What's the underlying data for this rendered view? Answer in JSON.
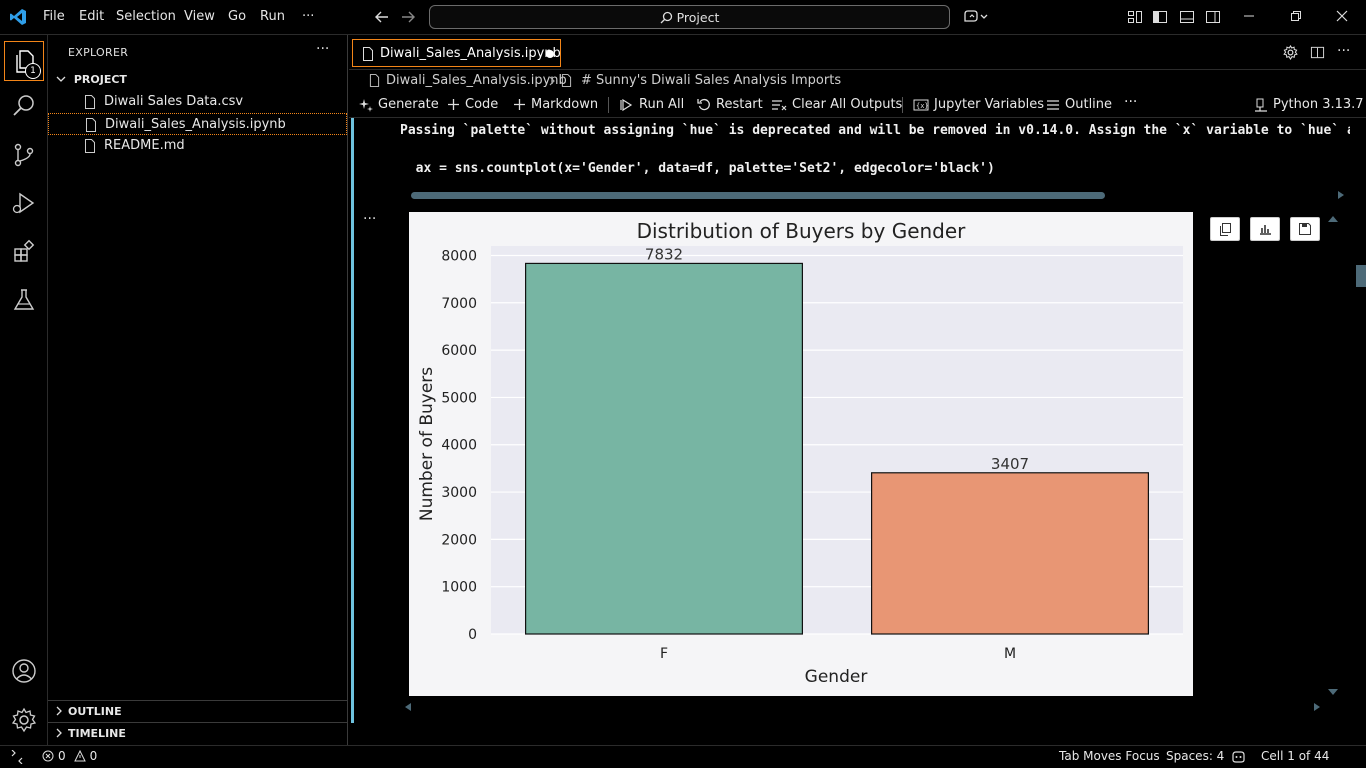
{
  "menu": [
    "File",
    "Edit",
    "Selection",
    "View",
    "Go",
    "Run",
    "···"
  ],
  "search": {
    "label": "Project"
  },
  "activity": {
    "explorer_badge": "1"
  },
  "explorer": {
    "title": "EXPLORER",
    "more": "···",
    "project": "PROJECT",
    "files": [
      "Diwali Sales Data.csv",
      "Diwali_Sales_Analysis.ipynb",
      "README.md"
    ],
    "outline": "OUTLINE",
    "timeline": "TIMELINE"
  },
  "editor": {
    "tab_label": "Diwali_Sales_Analysis.ipynb",
    "breadcrumb_file": "Diwali_Sales_Analysis.ipynb",
    "breadcrumb_cell": "# Sunny's Diwali Sales Analysis Imports",
    "toolbar": {
      "generate": "Generate",
      "code": "Code",
      "markdown": "Markdown",
      "run_all": "Run All",
      "restart": "Restart",
      "clear_outputs": "Clear All Outputs",
      "variables": "Jupyter Variables",
      "outline": "Outline",
      "more": "···",
      "kernel": "Python 3.13.7"
    },
    "warning_line": "Passing `palette` without assigning `hue` is deprecated and will be removed in v0.14.0. Assign the `x` variable to `hue` and",
    "code_line": "  ax = sns.countplot(x='Gender', data=df, palette='Set2', edgecolor='black')",
    "cell_more": "···"
  },
  "chart_data": {
    "type": "bar",
    "title": "Distribution of Buyers by Gender",
    "xlabel": "Gender",
    "ylabel": "Number of Buyers",
    "categories": [
      "F",
      "M"
    ],
    "values": [
      7832,
      3407
    ],
    "value_labels": [
      "7832",
      "3407"
    ],
    "colors": [
      "#77b5a3",
      "#e89674"
    ],
    "ylim": [
      0,
      8200
    ],
    "yticks": [
      0,
      1000,
      2000,
      3000,
      4000,
      5000,
      6000,
      7000,
      8000
    ],
    "grid": true,
    "background": "#eaeaf2"
  },
  "status": {
    "errors": "0",
    "warnings": "0",
    "tab_focus": "Tab Moves Focus",
    "spaces": "Spaces: 4",
    "cell": "Cell 1 of 44"
  }
}
